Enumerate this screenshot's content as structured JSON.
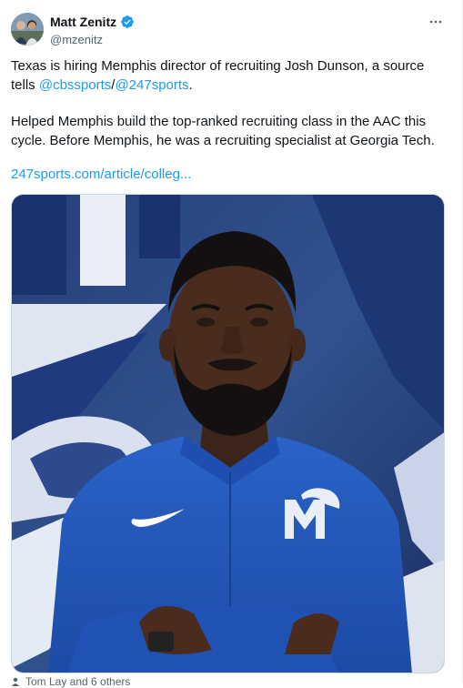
{
  "author": {
    "display_name": "Matt Zenitz",
    "handle": "@mzenitz",
    "verified": true
  },
  "tweet": {
    "line1_text": "Texas is hiring Memphis director of recruiting Josh Dunson, a source tells ",
    "mention1": "@cbssports",
    "separator": "/",
    "mention2": "@247sports",
    "line1_end": ".",
    "paragraph2": "Helped Memphis build the top-ranked recruiting class in the AAC this cycle. Before Memphis, he was a recruiting specialist at Georgia Tech.",
    "link": "247sports.com/article/colleg..."
  },
  "media": {
    "icon": "photo"
  },
  "footer": {
    "tagged_text": "Tom Lay and 6 others"
  },
  "colors": {
    "accent": "#1d9bf0",
    "text": "#0f1419",
    "muted": "#536471",
    "memphis_blue": "#1e4fb0"
  }
}
